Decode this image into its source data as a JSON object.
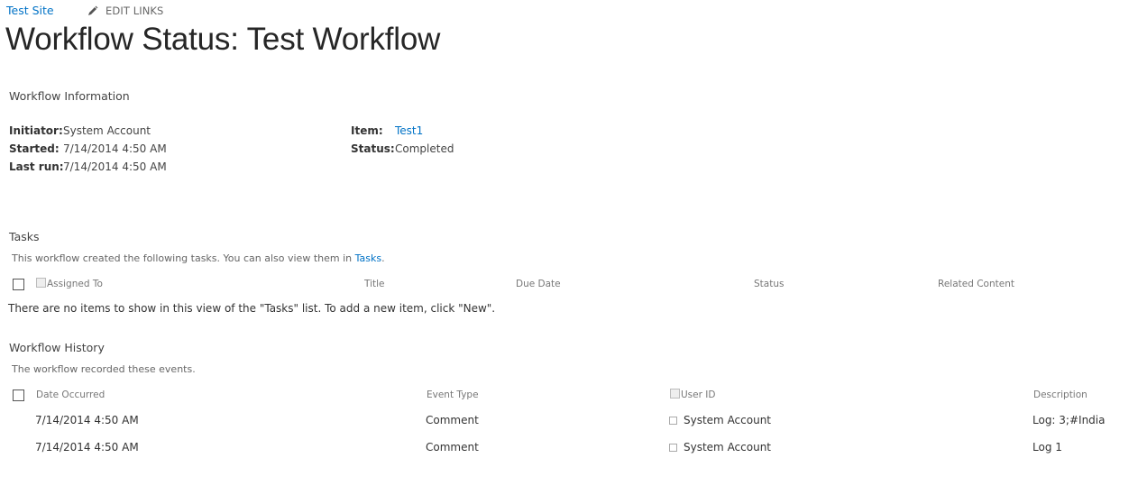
{
  "header": {
    "site_link": "Test Site",
    "edit_links": "EDIT LINKS",
    "page_title": "Workflow Status: Test Workflow"
  },
  "workflow_info": {
    "section_title": "Workflow Information",
    "initiator_label": "Initiator:",
    "initiator_value": "System Account",
    "started_label": "Started:",
    "started_value": "7/14/2014 4:50 AM",
    "last_run_label": "Last run:",
    "last_run_value": "7/14/2014 4:50 AM",
    "item_label": "Item:",
    "item_value": "Test1",
    "status_label": "Status:",
    "status_value": "Completed"
  },
  "tasks": {
    "section_title": "Tasks",
    "description_prefix": "This workflow created the following tasks. You can also view them in ",
    "description_link": "Tasks",
    "description_suffix": ".",
    "columns": [
      "Assigned To",
      "Title",
      "Due Date",
      "Status",
      "Related Content"
    ],
    "empty_message": "There are no items to show in this view of the \"Tasks\" list. To add a new item, click \"New\"."
  },
  "history": {
    "section_title": "Workflow History",
    "description": "The workflow recorded these events.",
    "columns": [
      "Date Occurred",
      "Event Type",
      "User ID",
      "Description"
    ],
    "rows": [
      {
        "date": "7/14/2014 4:50 AM",
        "event_type": "Comment",
        "user": "System Account",
        "description": "Log: 3;#India"
      },
      {
        "date": "7/14/2014 4:50 AM",
        "event_type": "Comment",
        "user": "System Account",
        "description": "Log 1"
      }
    ]
  }
}
